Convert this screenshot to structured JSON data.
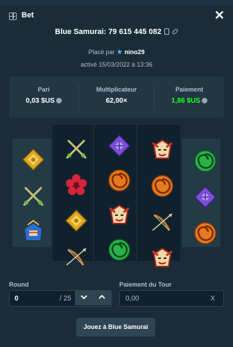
{
  "header": {
    "bet_label": "Bet",
    "close_symbol": "✕"
  },
  "title": "Blue Samurai: 79 615 445 082",
  "placed": {
    "prefix": "Placé par",
    "user": "nino29"
  },
  "activated": "activé 15/03/2022 à 13:36",
  "stats": {
    "bet": {
      "label": "Pari",
      "value": "0,03 $US"
    },
    "multiplier": {
      "label": "Multiplicateur",
      "value": "62,00×"
    },
    "payout": {
      "label": "Paiement",
      "value": "1,86 $US"
    }
  },
  "reels": [
    [
      "gold-diamond-icon",
      "crossed-swords-icon",
      "blue-samurai-icon"
    ],
    [
      "crossed-swords-icon",
      "red-flower-icon",
      "gold-diamond-icon",
      "bow-arrow-icon"
    ],
    [
      "purple-diamond-icon",
      "orange-spiral-icon",
      "samurai-mask-icon",
      "green-spiral-icon"
    ],
    [
      "samurai-mask-icon",
      "orange-spiral-icon",
      "bow-arrow-icon",
      "samurai-mask-icon"
    ],
    [
      "green-spiral-icon",
      "purple-diamond-icon",
      "orange-spiral-icon"
    ]
  ],
  "form": {
    "round_label": "Round",
    "round_value": "0",
    "round_total": "/ 25",
    "payout_label": "Paiement du Tour",
    "payout_placeholder": "0,00",
    "clear_symbol": "X"
  },
  "play_button": "Jouez à Blue Samurai",
  "colors": {
    "background": "#1a2c38",
    "panel": "#213743",
    "reel": "#0f212e",
    "accent_green": "#1fff20"
  }
}
